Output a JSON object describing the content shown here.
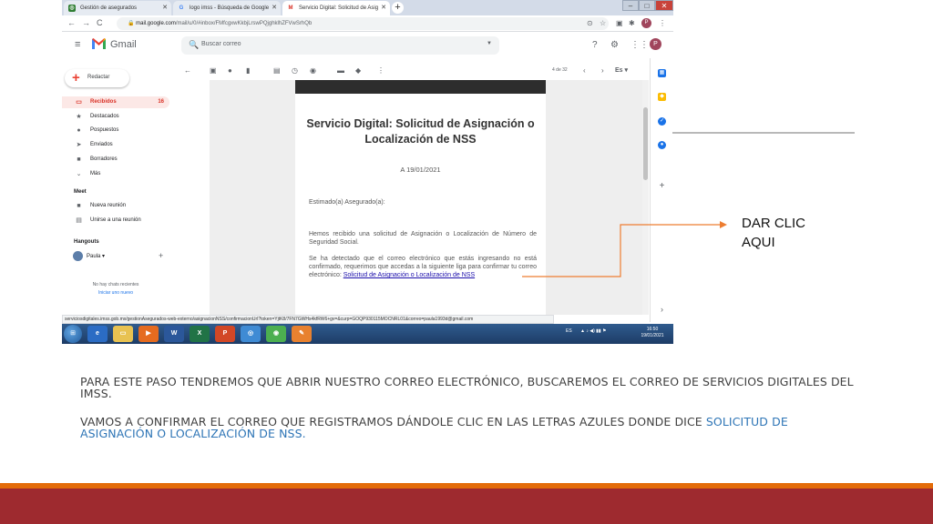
{
  "browser": {
    "tabs": [
      {
        "label": "Gestión de asegurados",
        "favicon": "imss-icon"
      },
      {
        "label": "logo imss - Búsqueda de Google",
        "favicon": "google-icon"
      },
      {
        "label": "Servicio Digital: Solicitud de Asig",
        "favicon": "gmail-icon"
      }
    ],
    "new_tab": "+",
    "url_host": "mail.google.com",
    "url_path": "/mail/u/0/#inbox/FMfcgxwKkbjLrswPQjghklhZFVwSrhQb",
    "profile_initial": "P"
  },
  "gmail": {
    "brand": "Gmail",
    "search_placeholder": "Buscar correo",
    "avatar_initial": "P",
    "compose_label": "Redactar",
    "nav": [
      {
        "icon": "inbox-icon",
        "label": "Recibidos",
        "count": "16"
      },
      {
        "icon": "star-icon",
        "label": "Destacados"
      },
      {
        "icon": "clock-icon",
        "label": "Pospuestos"
      },
      {
        "icon": "send-icon",
        "label": "Enviados"
      },
      {
        "icon": "file-icon",
        "label": "Borradores"
      },
      {
        "icon": "chevron-down-icon",
        "label": "Más"
      }
    ],
    "meet_title": "Meet",
    "meet_items": [
      "Nueva reunión",
      "Unirse a una reunión"
    ],
    "hangouts_title": "Hangouts",
    "hangouts_user": "Paula",
    "no_chats": "No hay chats recientes",
    "start_new": "Iniciar uno nuevo",
    "pager_text": "4 de 32",
    "lang": "Es"
  },
  "email": {
    "title": "Servicio Digital: Solicitud de Asignación o Localización de NSS",
    "date": "A 19/01/2021",
    "greeting": "Estimado(a) Asegurado(a):",
    "p1": "Hemos recibido una solicitud de Asignación o Localización de Número de Seguridad Social.",
    "p2_before": "Se ha detectado que el correo electrónico que estás ingresando no está confirmado, requerimos que accedas a la siguiente liga para confirmar tu correo electrónico: ",
    "p2_link": "Solicitud de Asignación o Localización de NSS"
  },
  "status_url": "serviciosdigitales.imss.gob.mx/gestionAsegurados-web-externo/asignacionNSS/confirmacionUrl?token=YjtK8/7FN7GWHs4kfRW6+gv=&curp=GOQP930115MOCNRL01&correo=paula1993d@gmail.com",
  "taskbar": {
    "lang": "ES",
    "time": "16:50",
    "date": "19/01/2021"
  },
  "annotation": {
    "label": "DAR CLIC AQUI",
    "color": "#ed7d31"
  },
  "instructions": {
    "p1": "PARA ESTE PASO TENDREMOS QUE ABRIR NUESTRO CORREO ELECTRÓNICO, BUSCAREMOS EL CORREO DE SERVICIOS DIGITALES DEL IMSS.",
    "p2_before": "VAMOS A CONFIRMAR EL CORREO QUE REGISTRAMOS DÁNDOLE CLIC EN LAS LETRAS AZULES DONDE DICE ",
    "p2_blue": "SOLICITUD DE ASIGNACIÓN O LOCALIZACIÓN DE NSS."
  },
  "colors": {
    "footer_orange": "#e36c09",
    "footer_red": "#9e2a2f",
    "accent_blue": "#2e75b6"
  }
}
